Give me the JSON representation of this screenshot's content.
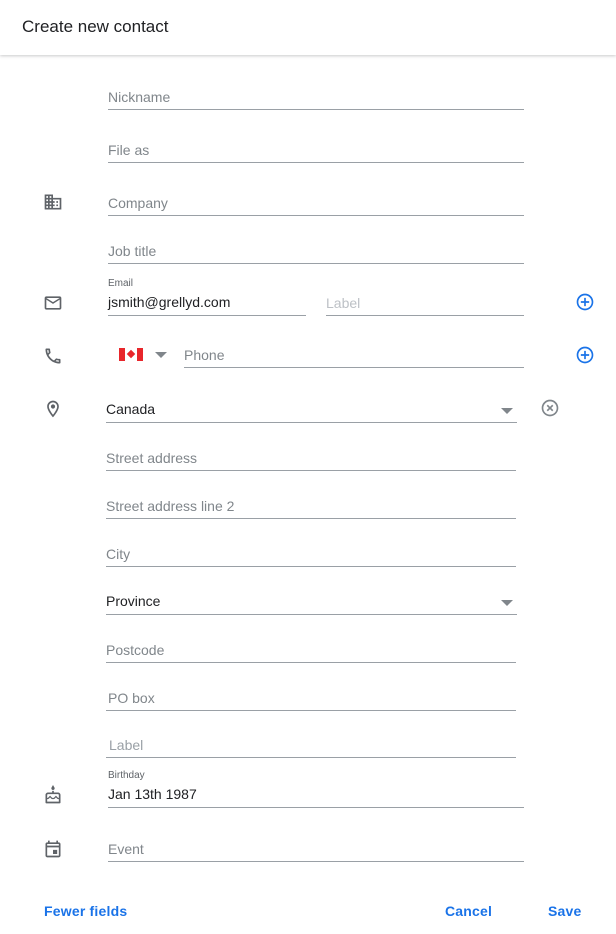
{
  "header": {
    "title": "Create new contact"
  },
  "form": {
    "nickname": {
      "placeholder": "Nickname"
    },
    "file_as": {
      "placeholder": "File as"
    },
    "company": {
      "placeholder": "Company"
    },
    "job_title": {
      "placeholder": "Job title"
    },
    "email": {
      "label": "Email",
      "value": "jsmith@grellyd.com",
      "type_placeholder": "Label"
    },
    "phone": {
      "country_flag": "canada-flag-icon",
      "placeholder": "Phone"
    },
    "address": {
      "country": "Canada",
      "street": "Street address",
      "street2": "Street address line 2",
      "city": "City",
      "province": "Province",
      "postcode": "Postcode",
      "po_box": "PO box",
      "label": "Label"
    },
    "birthday": {
      "label": "Birthday",
      "value": "Jan 13th 1987"
    },
    "event": {
      "placeholder": "Event"
    }
  },
  "icons": {
    "company": "building-icon",
    "email": "mail-icon",
    "phone": "phone-icon",
    "address": "location-pin-icon",
    "birthday": "cake-icon",
    "event": "calendar-icon",
    "add": "add-circle-icon",
    "remove": "remove-circle-icon"
  },
  "colors": {
    "accent": "#1a73e8",
    "icon": "#5f6368",
    "underline": "#9aa0a6"
  },
  "footer": {
    "fewer_fields": "Fewer fields",
    "cancel": "Cancel",
    "save": "Save"
  }
}
